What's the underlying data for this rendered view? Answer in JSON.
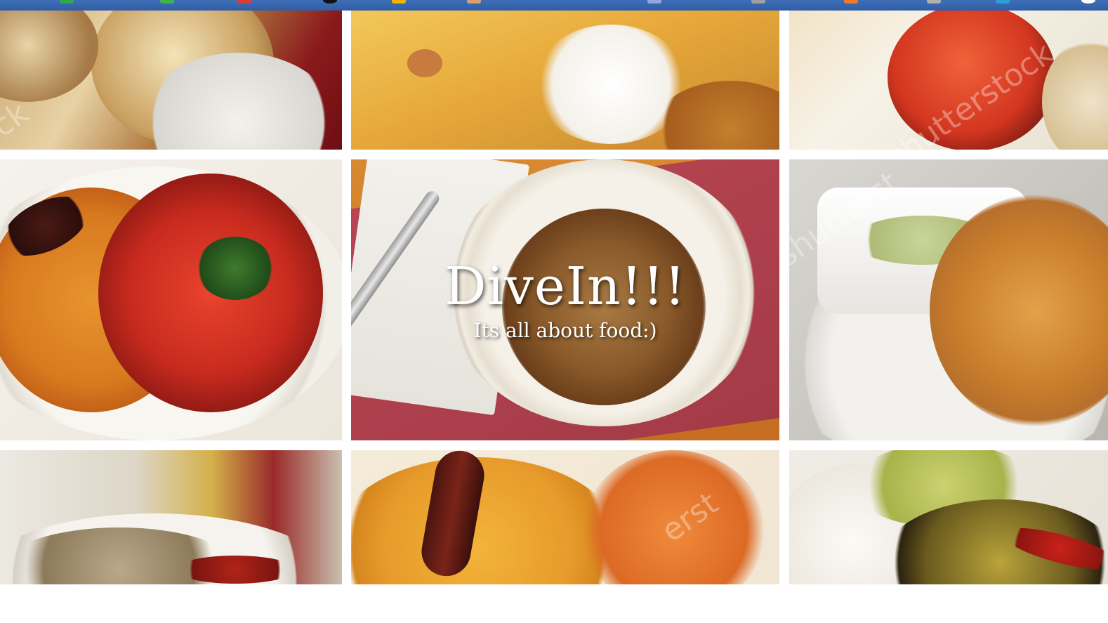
{
  "hero": {
    "title": "DiveIn!!!",
    "subtitle": "Its all about food:)"
  },
  "watermark": "shutterstock",
  "tiles": [
    {
      "name": "naan-basket-photo"
    },
    {
      "name": "rice-and-raita-photo"
    },
    {
      "name": "tandoori-chicken-photo"
    },
    {
      "name": "paneer-tikka-rice-photo"
    },
    {
      "name": "fried-chicken-plate-photo"
    },
    {
      "name": "biryani-with-chutney-photo"
    },
    {
      "name": "curry-dish-photo"
    },
    {
      "name": "rice-and-chicken-photo"
    },
    {
      "name": "rice-with-vegetables-photo"
    }
  ],
  "colors": {
    "bookmarks_bar": "#3566b0",
    "tile_gap": "#ffffff"
  }
}
